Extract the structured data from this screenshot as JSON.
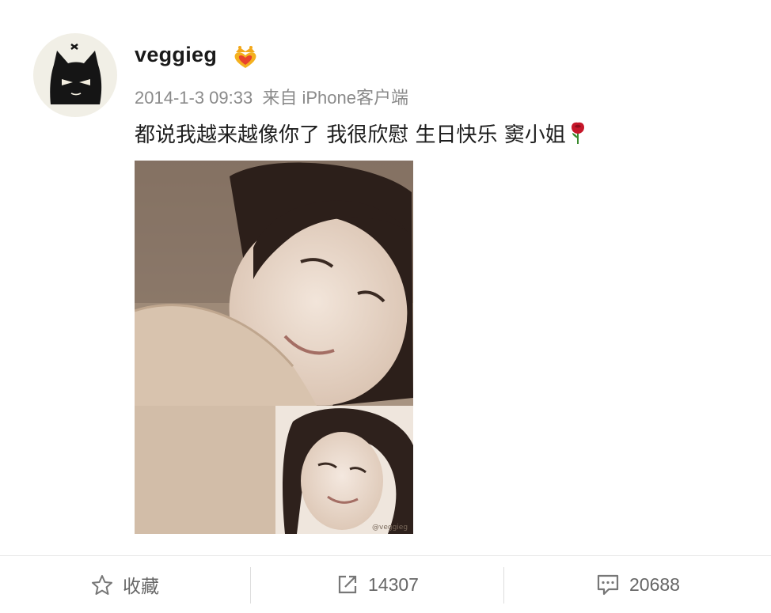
{
  "post": {
    "username": "veggieg",
    "badge_icon": "crown-heart-badge-icon",
    "timestamp": "2014-1-3 09:33",
    "source": "来自 iPhone客户端",
    "text": "都说我越来越像你了 我很欣慰 生日快乐 窦小姐",
    "emoji_icon": "rose-icon",
    "photo_watermark": "@veggieg"
  },
  "actions": {
    "favorite": {
      "icon": "star-icon",
      "label": "收藏"
    },
    "repost": {
      "icon": "share-arrow-icon",
      "count": "14307"
    },
    "comment": {
      "icon": "comment-icon",
      "count": "20688"
    }
  },
  "colors": {
    "meta_text": "#8a8a8a",
    "action_text": "#666666",
    "divider": "#e8e8e8"
  }
}
